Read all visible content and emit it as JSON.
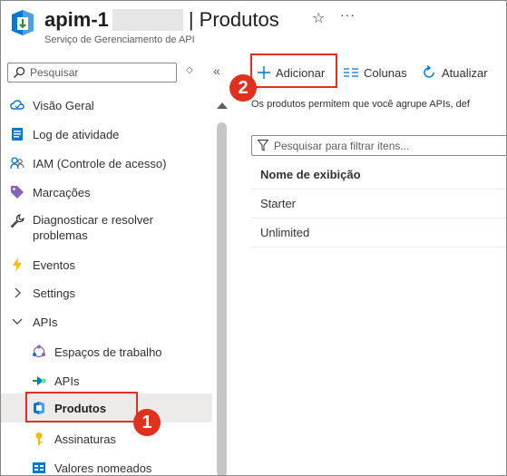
{
  "header": {
    "resource_name": "apim-1",
    "separator": "|",
    "page_title": "Produtos",
    "subtitle": "Serviço de Gerenciamento de API",
    "star_label": "☆",
    "more_label": "···"
  },
  "sidebar": {
    "search_placeholder": "Pesquisar",
    "items": [
      {
        "label": "Visão Geral",
        "icon": "cloud-icon"
      },
      {
        "label": "Log de atividade",
        "icon": "activity-log-icon"
      },
      {
        "label": "IAM (Controle de acesso)",
        "icon": "people-icon"
      },
      {
        "label": "Marcações",
        "icon": "tag-icon"
      },
      {
        "label": "Diagnosticar e resolver problemas",
        "label_line1": "Diagnosticar e resolver",
        "label_line2": "problemas",
        "icon": "wrench-icon"
      },
      {
        "label": "Eventos",
        "icon": "lightning-icon"
      },
      {
        "label": "Settings",
        "icon": "chevron-right-icon"
      },
      {
        "label": "APIs",
        "icon": "chevron-down-icon"
      },
      {
        "label": "Espaços de trabalho",
        "icon": "workspaces-icon"
      },
      {
        "label": "APIs",
        "icon": "apis-icon"
      },
      {
        "label": "Produtos",
        "icon": "products-icon",
        "active": true
      },
      {
        "label": "Assinaturas",
        "icon": "key-icon"
      },
      {
        "label": "Valores nomeados",
        "icon": "named-values-icon"
      }
    ]
  },
  "toolbar": {
    "add_label": "Adicionar",
    "columns_label": "Colunas",
    "refresh_label": "Atualizar"
  },
  "callouts": {
    "badge_1": "1",
    "badge_2": "2"
  },
  "main": {
    "description": "Os produtos permitem que você agrupe APIs, def",
    "filter_placeholder": "Pesquisar para filtrar itens...",
    "column_header": "Nome de exibição",
    "rows": [
      "Starter",
      "Unlimited"
    ]
  },
  "colors": {
    "accent": "#0078d4",
    "highlight": "#e0301e",
    "active_bg": "#edebe9"
  }
}
